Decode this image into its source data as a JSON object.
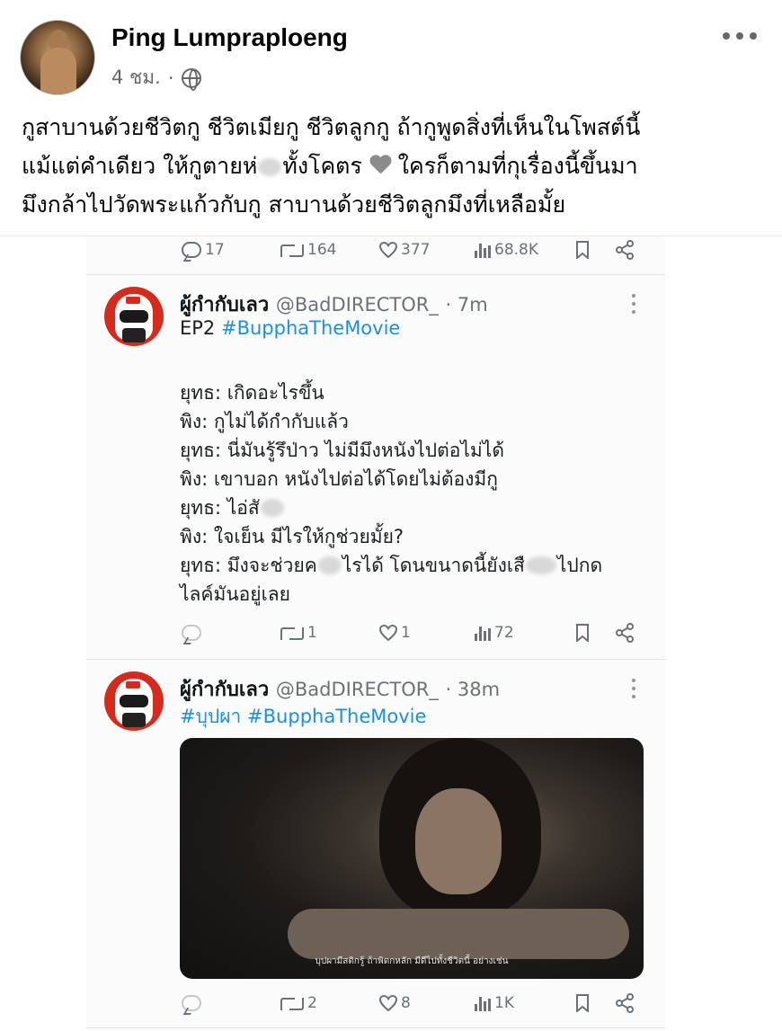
{
  "post": {
    "author": "Ping Lumpraploeng",
    "time": "4 ชม.",
    "separator": "·",
    "privacy_icon": "globe-icon",
    "body": {
      "line1": "กูสาบานด้วยชีวิตกู ชีวิตเมียกู ชีวิตลูกกู ถ้ากูพูดสิ่งที่เห็นในโพสต์นี้",
      "line2_a": "แม้แต่คำเดียว ให้กูตายห่",
      "line2_b": "ทั้งโคตร",
      "line2_c": "ใครก็ตามที่กุเรื่องนี้ขึ้นมา",
      "line3": "มึงกล้าไปวัดพระแก้วกับกู สาบานด้วยชีวิตลูกมึงที่เหลือมั้ย"
    }
  },
  "screenshot": {
    "top_actions": {
      "replies": "17",
      "retweets": "164",
      "likes": "377",
      "views": "68.8K"
    },
    "tweet1": {
      "name": "ผู้กำกับเลว",
      "handle": "@BadDIRECTOR_",
      "time": "· 7m",
      "prefix": "EP2",
      "hashtag": "#BupphaTheMovie",
      "lines": [
        "ยุทธ: เกิดอะไรขึ้น",
        "พิง: กูไม่ได้กำกับแล้ว",
        "ยุทธ: นี่มันรู้รึป่าว ไม่มีมึงหนังไปต่อไม่ได้",
        "พิง: เขาบอก หนังไปต่อได้โดยไม่ต้องมีกู",
        "ยุทธ: ไอ่สั",
        "พิง: ใจเย็น มีไรให้กูช่วยมั้ย?"
      ],
      "line7_a": "ยุทธ: มึงจะช่วยค",
      "line7_b": "ไรได้ โดนขนาดนี้ยังเสื",
      "line7_c": "ไปกด",
      "line8": "ไลค์มันอยู่เลย",
      "actions": {
        "replies": "",
        "retweets": "1",
        "likes": "1",
        "views": "72"
      }
    },
    "tweet2": {
      "name": "ผู้กำกับเลว",
      "handle": "@BadDIRECTOR_",
      "time": "· 38m",
      "hashtag1": "#บุปผา",
      "hashtag2": "#BupphaTheMovie",
      "image_subtitle": "บุปผามีสติกรู้ ถ้าพิดกหลัก มีดีไปทั้งชีวิตนี้ อย่างเช่น",
      "actions": {
        "replies": "",
        "retweets": "2",
        "likes": "8",
        "views": "1K"
      }
    }
  },
  "colors": {
    "link": "#1d8fe0",
    "meta_gray": "#65676b",
    "icon_gray": "#6b7178",
    "avatar_red": "#d62a1c"
  }
}
